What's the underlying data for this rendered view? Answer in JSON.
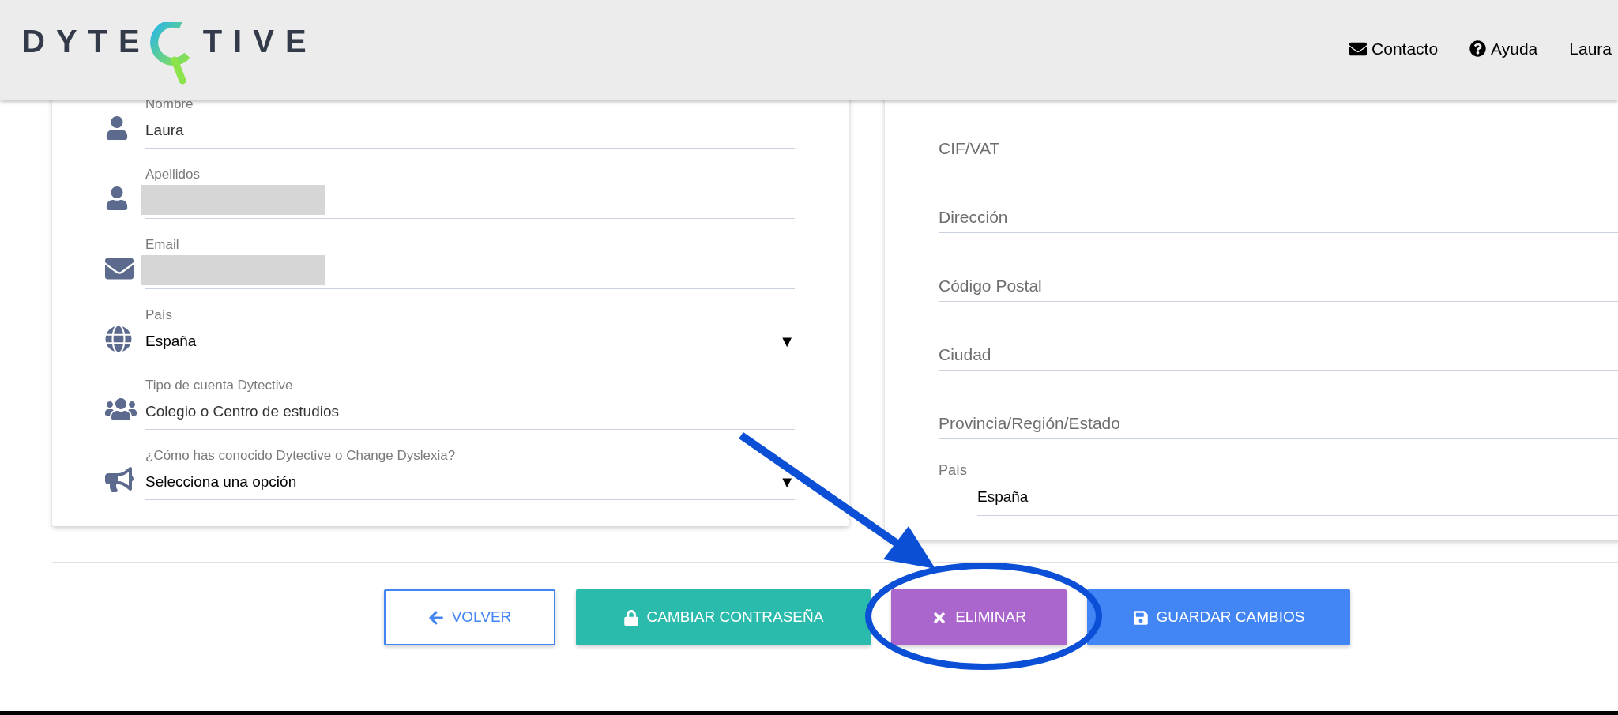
{
  "header": {
    "logo": [
      "DYTE",
      "TIVE"
    ],
    "nav": [
      {
        "kind": "mail",
        "label": "Contacto"
      },
      {
        "kind": "help",
        "label": "Ayuda"
      },
      {
        "kind": "plain",
        "label": "Laura"
      }
    ]
  },
  "profile_form": {
    "fields": [
      {
        "kind": "text",
        "label": "Nombre",
        "value": "Laura"
      },
      {
        "kind": "redacted",
        "label": "Apellidos"
      },
      {
        "kind": "redacted",
        "label": "Email"
      },
      {
        "kind": "select",
        "label": "País",
        "value": "España",
        "arrow": "▼"
      },
      {
        "kind": "text",
        "label": "Tipo de cuenta Dytective",
        "value": "Colegio o Centro de estudios"
      },
      {
        "kind": "select",
        "label": "¿Cómo has conocido Dytective o Change Dyslexia?",
        "value": "Selecciona una opción",
        "arrow": "▼"
      }
    ]
  },
  "billing_form": {
    "fields": [
      {
        "kind": "text",
        "placeholder": "CIF/VAT"
      },
      {
        "kind": "text",
        "placeholder": "Dirección"
      },
      {
        "kind": "text",
        "placeholder": "Código Postal"
      },
      {
        "kind": "text",
        "placeholder": "Ciudad"
      },
      {
        "kind": "text",
        "placeholder": "Provincia/Región/Estado"
      },
      {
        "kind": "select",
        "label": "País",
        "value": "España"
      }
    ]
  },
  "buttons": [
    {
      "kind": "back",
      "label": "VOLVER"
    },
    {
      "kind": "password",
      "label": "CAMBIAR CONTRASEÑA"
    },
    {
      "kind": "delete",
      "label": "ELIMINAR"
    },
    {
      "kind": "save",
      "label": "GUARDAR CAMBIOS"
    }
  ]
}
